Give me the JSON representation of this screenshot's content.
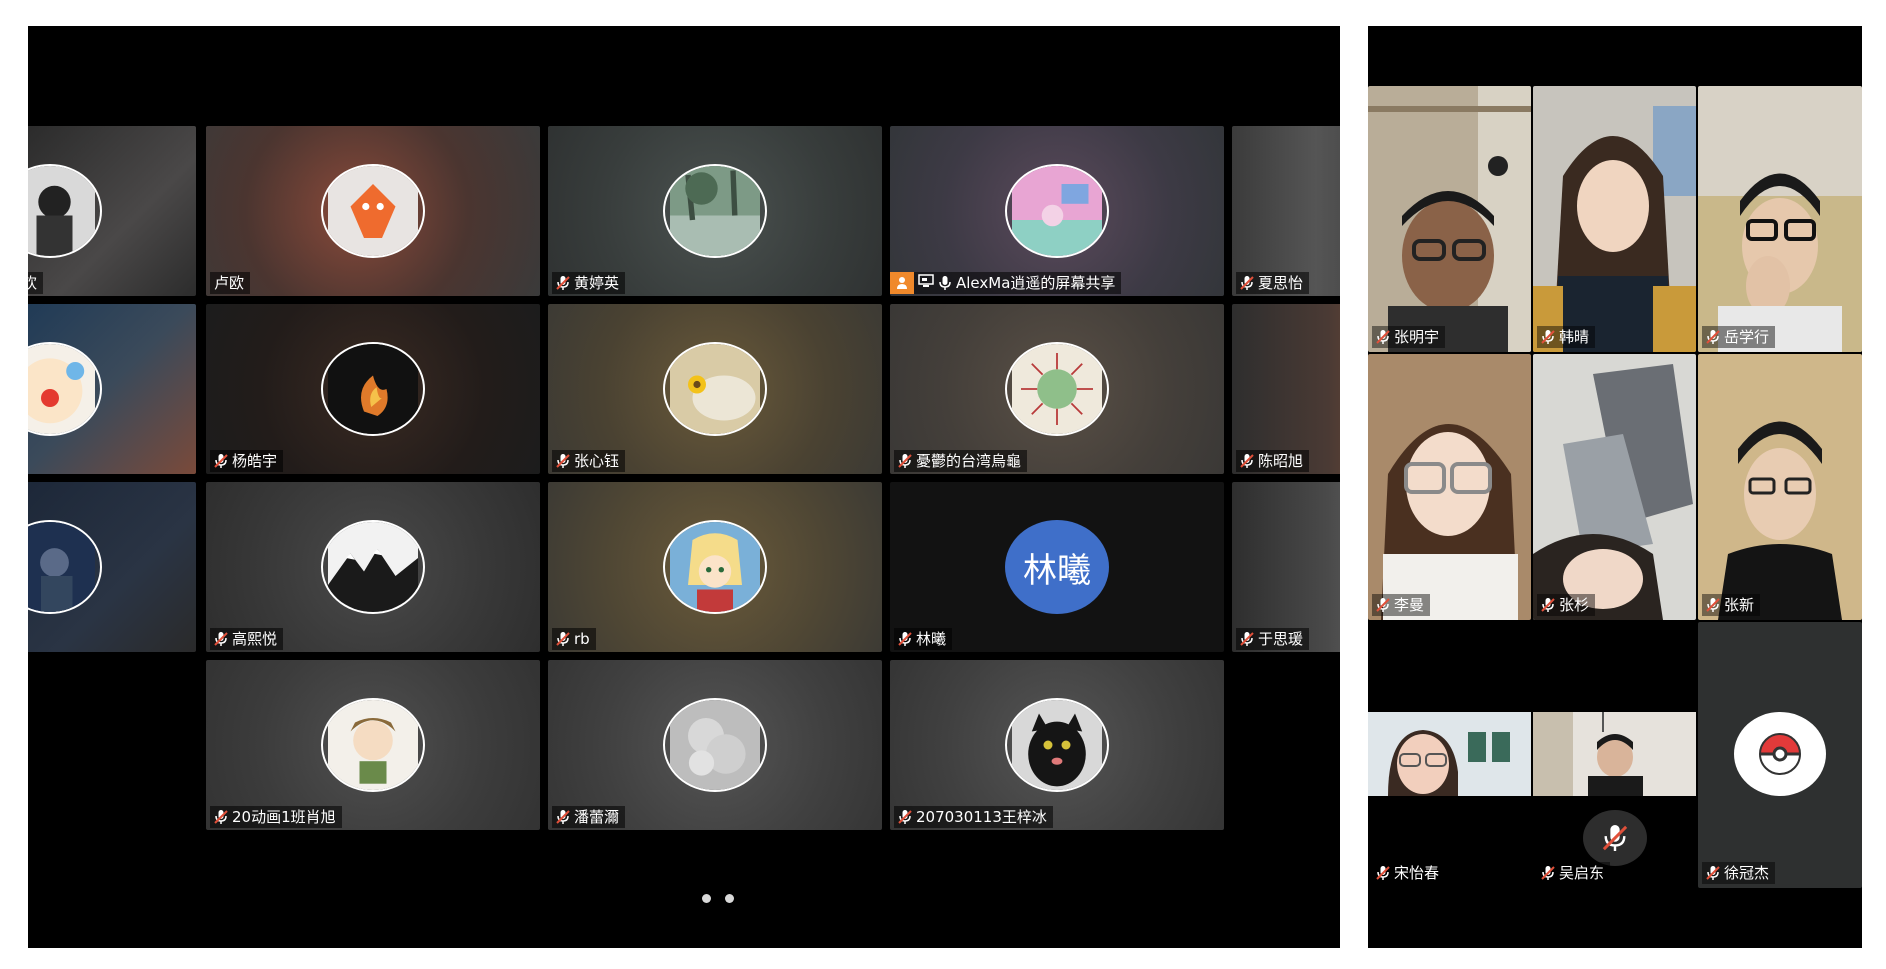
{
  "main_grid": {
    "tiles": [
      {
        "name": "欢",
        "partial": true
      },
      {
        "name": "卢欧",
        "muted": false
      },
      {
        "name": "黄婷英",
        "muted": true
      },
      {
        "name": "AlexMa逍遥的屏幕共享",
        "sharing": true
      },
      {
        "name": "夏思怡",
        "muted": true
      },
      {
        "name": "杨皓宇",
        "muted": true
      },
      {
        "name": "张心钰",
        "muted": true
      },
      {
        "name": "憂鬱的台湾烏龜",
        "muted": true
      },
      {
        "name": "陈昭旭",
        "muted": true
      },
      {
        "name": "高熙悦",
        "muted": true
      },
      {
        "name": "rb",
        "muted": true
      },
      {
        "name": "林曦",
        "muted": true,
        "avatar_text": "林曦",
        "avatar_color": "#3f6fc9"
      },
      {
        "name": "于思瑗",
        "muted": true
      },
      {
        "name": "20动画1班肖旭",
        "muted": true
      },
      {
        "name": "潘蕾濔",
        "muted": true
      },
      {
        "name": "207030113王梓冰",
        "muted": true
      }
    ],
    "page_dots": 2
  },
  "video_grid": {
    "tiles": [
      {
        "name": "张明宇"
      },
      {
        "name": "韩晴"
      },
      {
        "name": "岳学行"
      },
      {
        "name": "李曼"
      },
      {
        "name": "张杉"
      },
      {
        "name": "张新"
      },
      {
        "name": "宋怡春"
      },
      {
        "name": "吴启东"
      },
      {
        "name": "徐冠杰"
      }
    ]
  },
  "colors": {
    "background": "#000000",
    "muted_mic": "#e0503a",
    "share_badge": "#f0892b",
    "avatar_blue": "#3f6fc9"
  },
  "icons": [
    "muted-mic-icon",
    "person-icon",
    "screen-share-icon",
    "mic-icon",
    "pokeball-icon",
    "muted-mic-overlay-icon"
  ]
}
